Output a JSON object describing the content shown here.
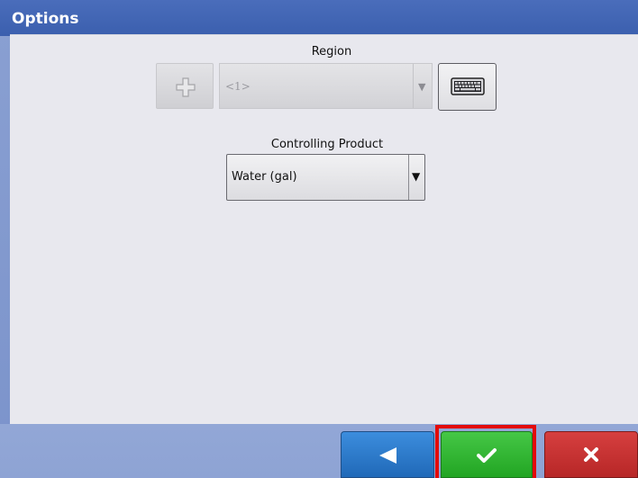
{
  "window": {
    "title": "Options"
  },
  "region": {
    "label": "Region",
    "selected_value": "<1>",
    "add_icon": "plus-icon",
    "keyboard_icon": "keyboard-icon",
    "dropdown_icon": "chevron-down-icon",
    "enabled": false
  },
  "controlling_product": {
    "label": "Controlling Product",
    "selected_value": "Water (gal)",
    "dropdown_icon": "chevron-down-icon"
  },
  "footer": {
    "back_icon": "back-arrow-icon",
    "ok_icon": "checkmark-icon",
    "cancel_icon": "close-icon",
    "highlighted_button": "ok"
  },
  "colors": {
    "title_bar": "#3b5fae",
    "back_button": "#2a78c8",
    "ok_button": "#30b531",
    "cancel_button": "#c73232",
    "highlight": "#e30b0b"
  }
}
